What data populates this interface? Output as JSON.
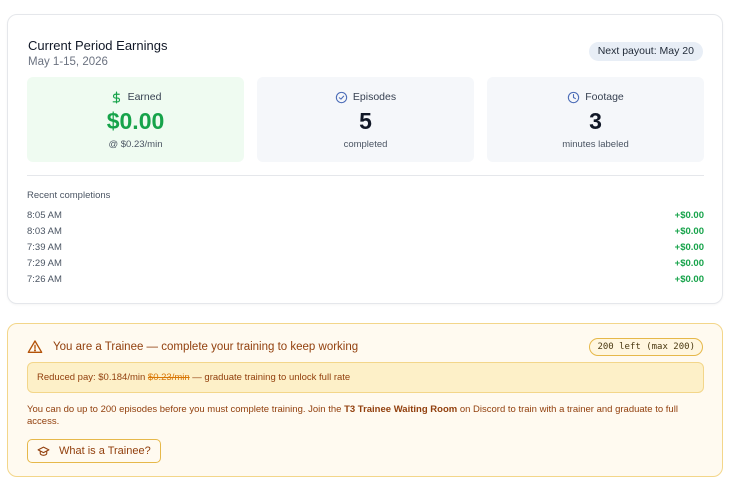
{
  "earnings": {
    "title": "Current Period Earnings",
    "period": "May 1-15, 2026",
    "payout_badge": "Next payout: May 20",
    "stats": {
      "earned": {
        "label": "Earned",
        "value": "$0.00",
        "sub": "@ $0.23/min",
        "icon": "dollar-icon"
      },
      "episodes": {
        "label": "Episodes",
        "value": "5",
        "sub": "completed",
        "icon": "check-circle-icon"
      },
      "footage": {
        "label": "Footage",
        "value": "3",
        "sub": "minutes labeled",
        "icon": "clock-icon"
      }
    },
    "recent_title": "Recent completions",
    "recent": [
      {
        "time": "8:05 AM",
        "amount": "+$0.00"
      },
      {
        "time": "8:03 AM",
        "amount": "+$0.00"
      },
      {
        "time": "7:39 AM",
        "amount": "+$0.00"
      },
      {
        "time": "7:29 AM",
        "amount": "+$0.00"
      },
      {
        "time": "7:26 AM",
        "amount": "+$0.00"
      }
    ]
  },
  "trainee": {
    "title": "You are a Trainee — complete your training to keep working",
    "badge": "200 left (max 200)",
    "reduced_prefix": "Reduced pay: $0.184/min",
    "reduced_strike": "$0.23/min",
    "reduced_suffix": "— graduate training to unlock full rate",
    "desc_before": "You can do up to 200 episodes before you must complete training. Join the",
    "desc_bold": "T3 Trainee Waiting Room",
    "desc_after": "on Discord to train with a trainer and graduate to full access.",
    "button_label": "What is a Trainee?",
    "icons": {
      "warning": "warning-icon",
      "button": "graduation-cap-icon"
    }
  },
  "colors": {
    "green": "#16a34a",
    "amber_text": "#92400e",
    "amber_border": "#f3d68a"
  }
}
